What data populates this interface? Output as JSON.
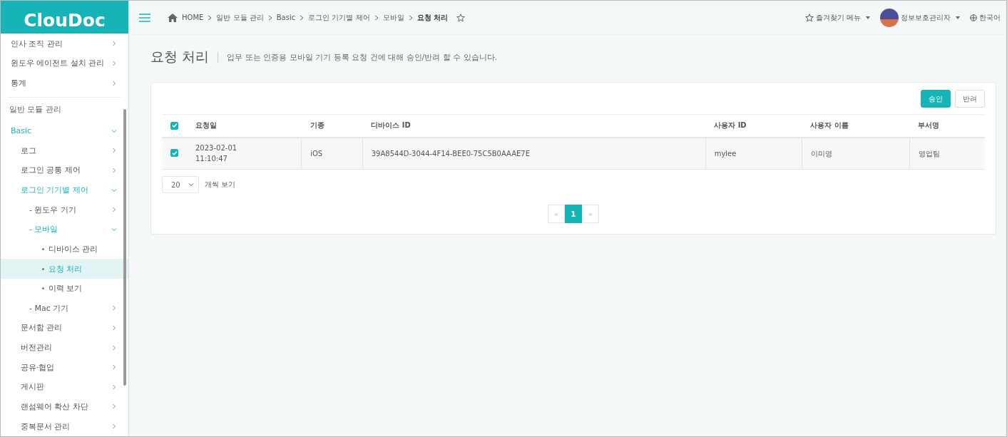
{
  "sidebar": {
    "logo": "ClouDoc",
    "top_items": [
      {
        "label": "인사 조직 관리",
        "expanded": false
      },
      {
        "label": "윈도우 에이전트 설치 관리",
        "expanded": false
      },
      {
        "label": "통계",
        "expanded": false
      }
    ],
    "section_title": "일반 모듈 관리",
    "items": [
      {
        "label": "Basic",
        "expanded": true,
        "children": [
          {
            "label": "로그",
            "expanded": false
          },
          {
            "label": "로그인 공통 제어",
            "expanded": false
          },
          {
            "label": "로그인 기기별 제어",
            "expanded": true,
            "children": [
              {
                "label": "- 윈도우 기기",
                "expanded": false
              },
              {
                "label": "- 모바일",
                "expanded": true,
                "children": [
                  {
                    "label": "디바이스 관리",
                    "selected": false
                  },
                  {
                    "label": "요청 처리",
                    "selected": true
                  },
                  {
                    "label": "이력 보기",
                    "selected": false
                  }
                ]
              },
              {
                "label": "- Mac 기기",
                "expanded": false
              }
            ]
          },
          {
            "label": "문서함 관리",
            "expanded": false
          },
          {
            "label": "버전관리",
            "expanded": false
          },
          {
            "label": "공유·협업",
            "expanded": false
          },
          {
            "label": "게시판",
            "expanded": false
          },
          {
            "label": "랜섬웨어 확산 차단",
            "expanded": false
          },
          {
            "label": "중복문서 관리",
            "expanded": false
          }
        ]
      }
    ]
  },
  "breadcrumb": [
    "HOME",
    "일반 모듈 관리",
    "Basic",
    "로그인 기기별 제어",
    "모바일",
    "요청 처리"
  ],
  "topbar": {
    "favorites": "즐겨찾기 메뉴",
    "user": "정보보호관리자",
    "language": "한국어"
  },
  "page": {
    "title": "요청 처리",
    "description": "업무 또는 인증용 모바일 기기 등록 요청 건에 대해 승인/반려 할 수 있습니다."
  },
  "buttons": [
    {
      "label": "승인",
      "kind": "primary"
    },
    {
      "label": "반려",
      "kind": "default"
    }
  ],
  "table": {
    "all_checked": true,
    "columns": [
      "요청일",
      "기종",
      "디바이스 ID",
      "사용자 ID",
      "사용자 이름",
      "부서명"
    ],
    "rows": [
      {
        "checked": true,
        "cells": [
          "2023-02-01\n11:10:47",
          "iOS",
          "39A8544D-3044-4F14-BEE0-75C5B0AAAE7E",
          "mylee",
          "이미영",
          "영업팀"
        ]
      }
    ]
  },
  "page_size": {
    "value": "20",
    "label": "개씩 보기"
  },
  "pagination": {
    "prev": "«",
    "next": "»",
    "pages": [
      {
        "label": "1",
        "selected": true
      }
    ]
  }
}
